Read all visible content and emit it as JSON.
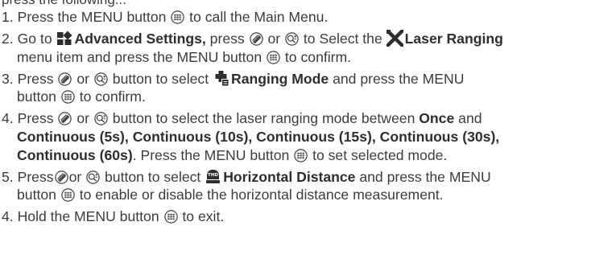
{
  "cut_line": "press the following...",
  "steps": [
    {
      "num": "1.",
      "t1": "Press the MENU button",
      "t2": "to call the Main Menu."
    },
    {
      "num": "2.",
      "t1": "Go to",
      "b1": "Advanced Settings,",
      "t2": "press",
      "t3": "or",
      "t4": "to Select the",
      "b2": "Laser Ranging",
      "t5": "menu item and press the MENU button",
      "t6": "to confirm."
    },
    {
      "num": "3.",
      "t1": "Press",
      "t2": "or",
      "t3": "button to select",
      "b1": "Ranging Mode",
      "t4": "and press the MENU",
      "t5": "button",
      "t6": "to confirm."
    },
    {
      "num": "4.",
      "t1": "Press",
      "t2": "or",
      "t3": "button to select the laser ranging mode between",
      "b1": "Once",
      "t4": "and",
      "b2": "Continuous (5s),",
      "b3": "Continuous (10s),",
      "b4": "Continuous (15s),",
      "b5": "Continuous (30s),",
      "b6": "Continuous (60s)",
      "t5": ". Press the MENU button",
      "t6": "to set selected mode."
    },
    {
      "num": "5.",
      "t1": "Press",
      "t2": "or",
      "t3": "button to select",
      "b1": "Horizontal Distance",
      "t4": "and press the MENU",
      "t5": "button",
      "t6": "to enable or disable the horizontal distance measurement."
    },
    {
      "num": "4.",
      "t1": "Hold the MENU button",
      "t2": "to exit."
    }
  ],
  "icons": {
    "menu": "menu-button-icon",
    "zoom": "zoom-wheel-icon",
    "plus_minus": "plus-minus-button-icon",
    "advanced_settings": "advanced-settings-icon",
    "laser_ranging": "laser-ranging-icon",
    "ranging_mode": "ranging-mode-icon",
    "horizontal_distance": "horizontal-distance-icon"
  }
}
